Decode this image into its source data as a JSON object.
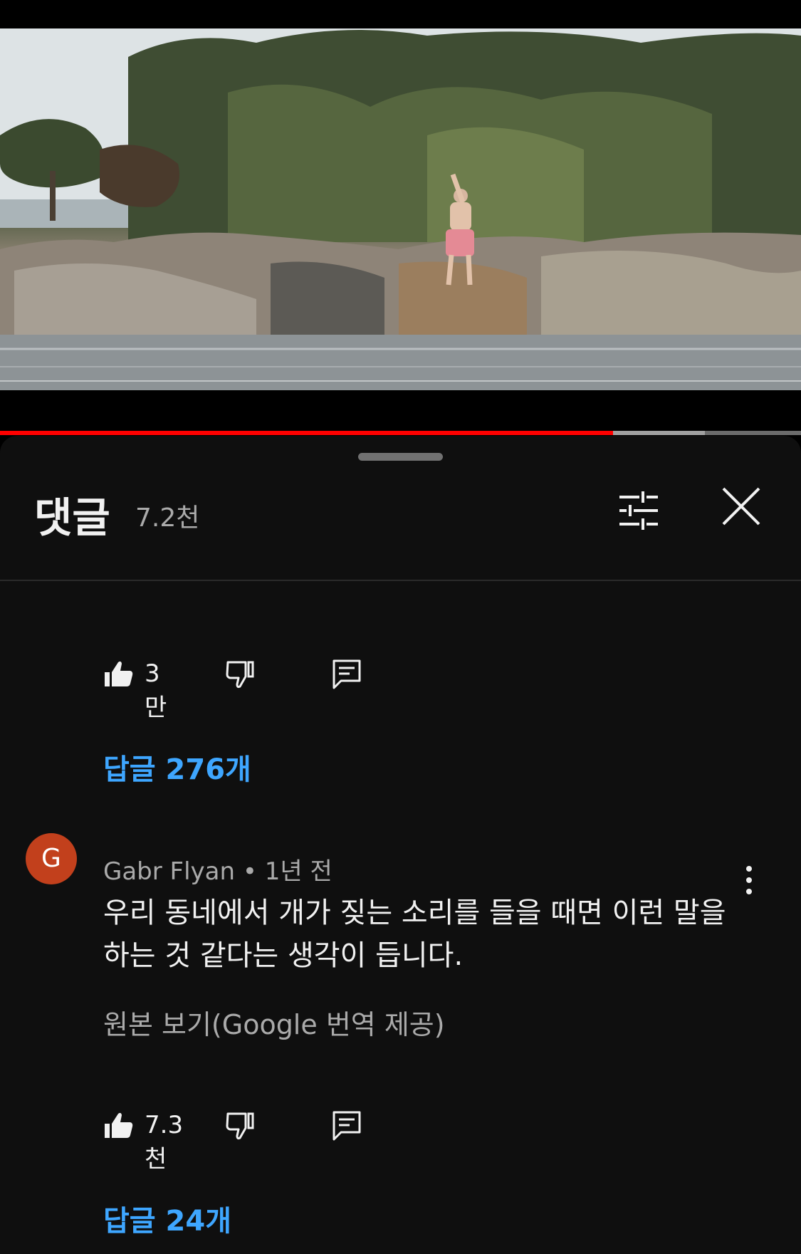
{
  "video": {
    "progress_played": 0.765,
    "progress_buffered": 0.88
  },
  "comments_panel": {
    "title": "댓글",
    "count": "7.2천",
    "icons": {
      "filter": "sort-filter-icon",
      "close": "close-icon"
    }
  },
  "previous_comment": {
    "likes": "3만",
    "replies_label": "답글 276개"
  },
  "comment": {
    "avatar_letter": "G",
    "avatar_color": "#c2401c",
    "author": "Gabr Flyan",
    "separator": "•",
    "time": "1년 전",
    "text": "우리 동네에서 개가 짖는 소리를 들을 때면 이런 말을 하는 것 같다는 생각이 듭니다.",
    "translate_label": "원본 보기(Google 번역 제공)",
    "likes": "7.3천",
    "replies_label": "답글 24개"
  },
  "colors": {
    "accent_link": "#3ea6ff",
    "progress": "#ff0000",
    "background": "#0f0f0f"
  }
}
